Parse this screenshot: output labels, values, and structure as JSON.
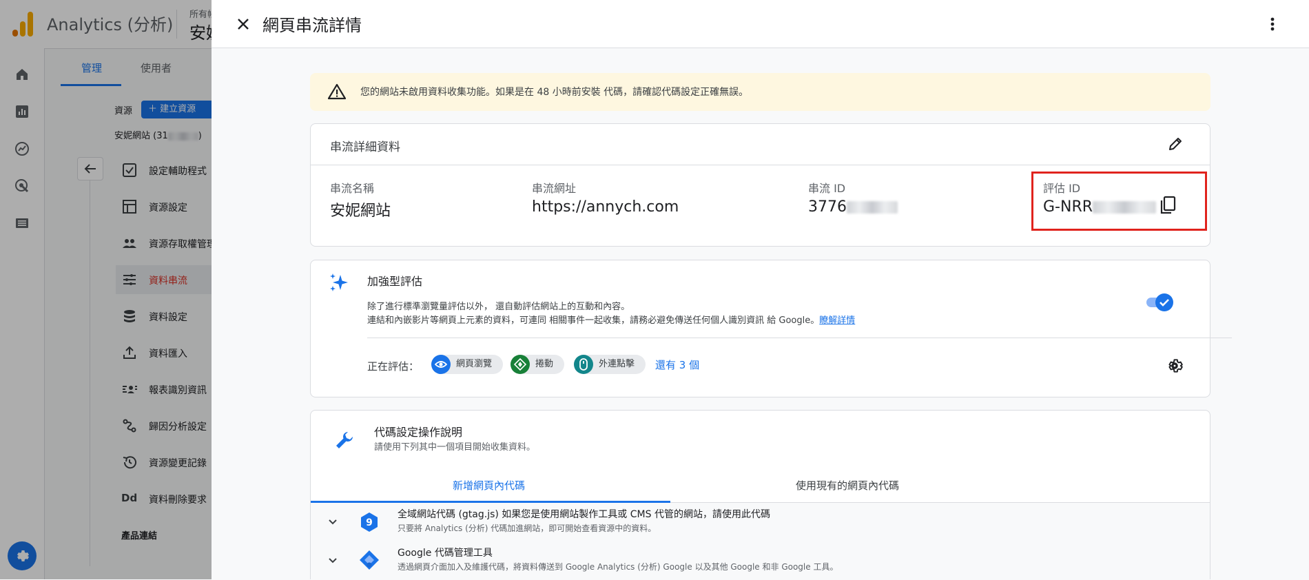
{
  "app": {
    "title": "Analytics (分析)",
    "account_label": "所有帳",
    "property_short": "安妮"
  },
  "admin": {
    "tabs": [
      "管理",
      "使用者"
    ],
    "resource_label": "資源",
    "create_button": "建立資源",
    "property_name": "安妮網站 (31",
    "menu": [
      {
        "label": "設定輔助程式",
        "icon": "checklist-icon"
      },
      {
        "label": "資源設定",
        "icon": "layout-icon"
      },
      {
        "label": "資源存取權管理",
        "icon": "people-icon"
      },
      {
        "label": "資料串流",
        "icon": "streams-icon",
        "active": true
      },
      {
        "label": "資料設定",
        "icon": "database-icon"
      },
      {
        "label": "資料匯入",
        "icon": "upload-icon"
      },
      {
        "label": "報表識別資訊",
        "icon": "id-icon"
      },
      {
        "label": "歸因分析設定",
        "icon": "attribution-icon"
      },
      {
        "label": "資源變更記錄",
        "icon": "history-icon"
      },
      {
        "label": "資料刪除要求",
        "icon": "dd-icon"
      }
    ],
    "product_links_label": "產品連結"
  },
  "drawer": {
    "title": "網頁串流詳情",
    "warning": "您的網站未啟用資料收集功能。如果是在 48 小時前安裝 代碼，請確認代碼設定正確無誤。",
    "stream_details": {
      "title": "串流詳細資料",
      "fields": [
        {
          "label": "串流名稱",
          "value": "安妮網站"
        },
        {
          "label": "串流網址",
          "value": "https://annych.com"
        },
        {
          "label": "串流 ID",
          "value": "3776"
        },
        {
          "label": "評估 ID",
          "value": "G-NRR"
        }
      ]
    },
    "enhanced": {
      "title": "加強型評估",
      "desc_line1": "除了進行標準瀏覽量評估以外， 還自動評估網站上的互動和內容。",
      "desc_line2": "連結和內嵌影片等網頁上元素的資料，可連同 相關事件一起收集，請務必避免傳送任何個人識別資訊 給 Google。",
      "learn_more": "瞭解詳情",
      "toggle_on": true,
      "measuring_label": "正在評估：",
      "chips": [
        "網頁瀏覽",
        "捲動",
        "外連點擊"
      ],
      "more": "還有 3 個"
    },
    "tagging": {
      "title": "代碼設定操作說明",
      "subtitle": "請使用下列其中一個項目開始收集資料。",
      "tabs": [
        "新增網頁內代碼",
        "使用現有的網頁內代碼"
      ],
      "options": [
        {
          "title": "全域網站代碼 (gtag.js) 如果您是使用網站製作工具或 CMS 代管的網站，請使用此代碼",
          "subtitle": "只要將 Analytics (分析) 代碼加進網站，即可開始查看資源中的資料。"
        },
        {
          "title": "Google 代碼管理工具",
          "subtitle": "透過網頁介面加入及維護代碼，將資料傳送到 Google Analytics (分析) Google 以及其他 Google 和非 Google 工具。"
        }
      ]
    }
  },
  "colors": {
    "accent": "#1a73e8",
    "highlight": "#e0231d",
    "warning_bg": "#fef7e0",
    "logo_orange": "#f9ab00",
    "logo_dark": "#e37400"
  }
}
